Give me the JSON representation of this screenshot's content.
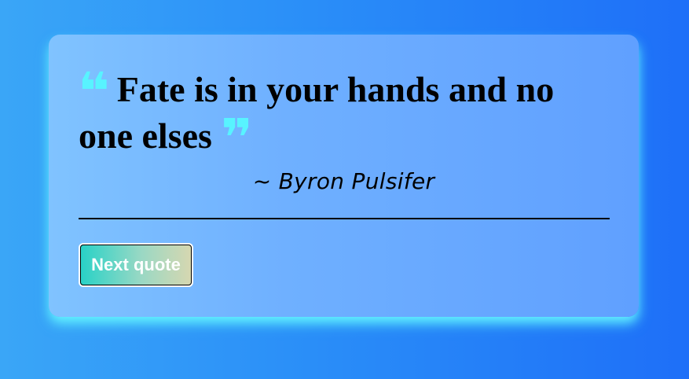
{
  "quote": {
    "text": "Fate is in your hands and no one elses",
    "author": "~ Byron Pulsifer",
    "open_mark": "❝",
    "close_mark": "❞"
  },
  "controls": {
    "next_label": "Next quote"
  },
  "colors": {
    "background_left": "#3aa6f7",
    "background_right": "#1e6ff8",
    "card_left": "#80c3ff",
    "card_right": "#60a0ff",
    "quote_mark": "#58f3ff",
    "card_glow": "#67f5ff",
    "button_left": "#27d2c7",
    "button_right": "#d7d7b0"
  }
}
